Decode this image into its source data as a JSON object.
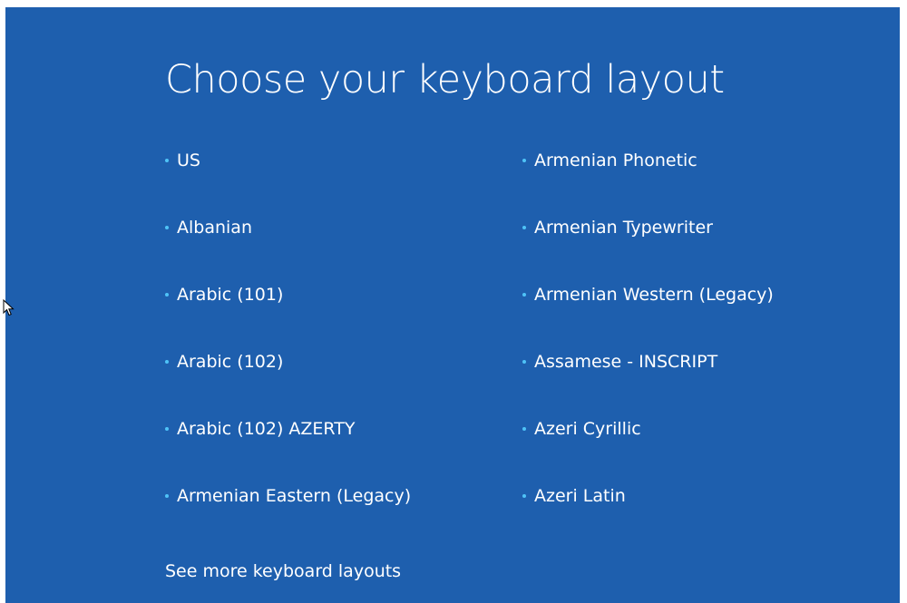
{
  "title": "Choose your keyboard layout",
  "layouts_left": [
    {
      "label": "US"
    },
    {
      "label": "Albanian"
    },
    {
      "label": "Arabic (101)"
    },
    {
      "label": "Arabic (102)"
    },
    {
      "label": "Arabic (102) AZERTY"
    },
    {
      "label": "Armenian Eastern (Legacy)"
    }
  ],
  "layouts_right": [
    {
      "label": "Armenian Phonetic"
    },
    {
      "label": "Armenian Typewriter"
    },
    {
      "label": "Armenian Western (Legacy)"
    },
    {
      "label": "Assamese - INSCRIPT"
    },
    {
      "label": "Azeri Cyrillic"
    },
    {
      "label": "Azeri Latin"
    }
  ],
  "see_more_label": "See more keyboard layouts",
  "colors": {
    "background": "#1e5fae",
    "text": "#ffffff",
    "bullet": "#4fc3f7"
  },
  "icons": {
    "cursor": "mouse-pointer-icon",
    "bullet": "bullet-dot-icon"
  }
}
